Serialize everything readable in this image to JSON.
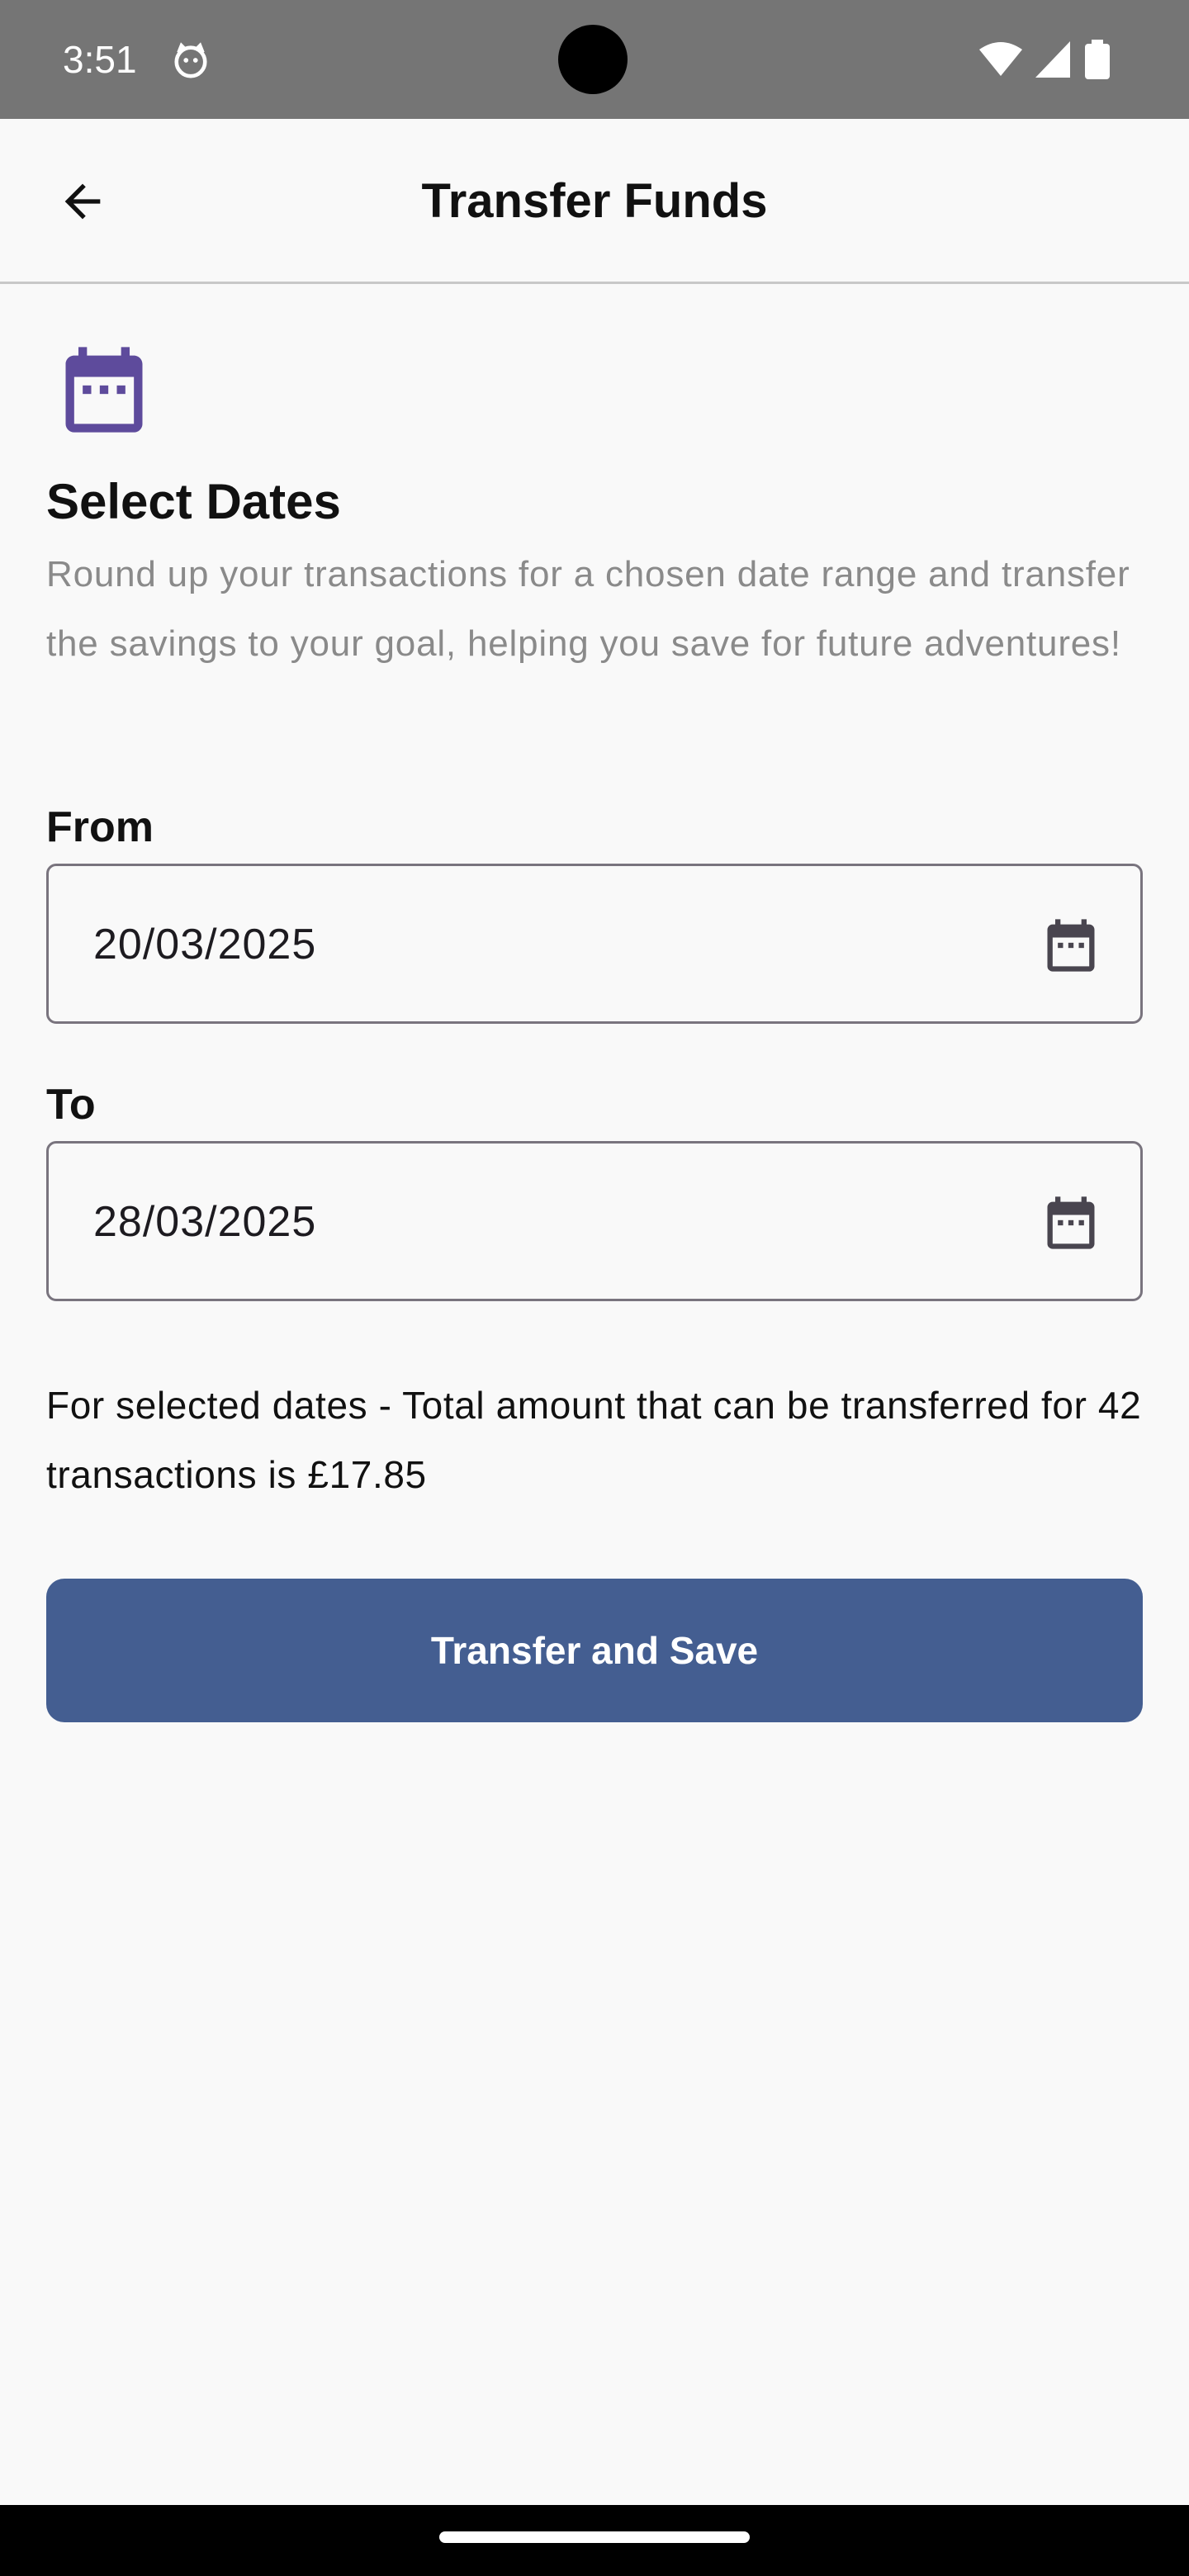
{
  "status_bar": {
    "time": "3:51",
    "notification_icon": "cat-face-icon",
    "wifi_icon": "wifi-icon",
    "signal_icon": "signal-icon",
    "battery_icon": "battery-icon"
  },
  "app_bar": {
    "back_icon": "arrow-back-icon",
    "title": "Transfer Funds"
  },
  "section": {
    "icon": "calendar-icon",
    "title": "Select Dates",
    "description": "Round up your transactions for a chosen date range and transfer the savings to your goal, helping you save for future adventures!"
  },
  "from_field": {
    "label": "From",
    "value": "20/03/2025",
    "icon": "calendar-icon"
  },
  "to_field": {
    "label": "To",
    "value": "28/03/2025",
    "icon": "calendar-icon"
  },
  "summary": "For selected dates - Total amount that can be transferred for 42 transactions is £17.85",
  "primary_button": {
    "label": "Transfer and Save"
  },
  "colors": {
    "accent_purple": "#5e4b9c",
    "button_blue": "#445e91",
    "status_bar_gray": "#757575",
    "background": "#f9f9f9",
    "description_gray": "#8a8a8a",
    "field_border": "#79747e"
  }
}
